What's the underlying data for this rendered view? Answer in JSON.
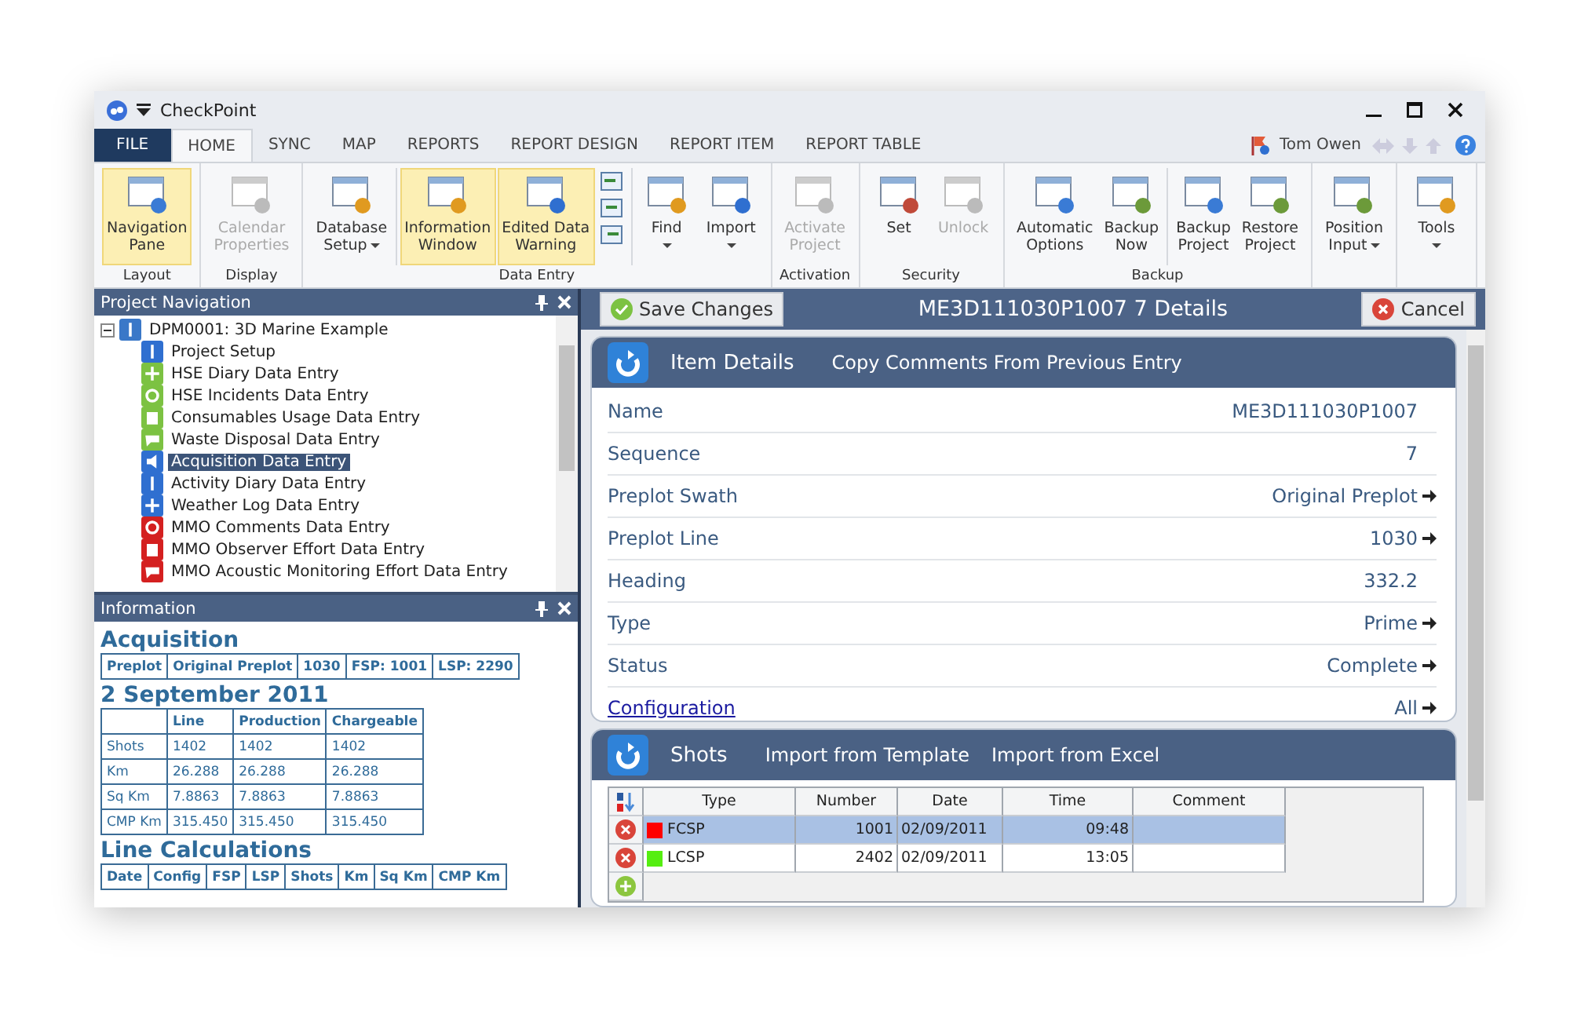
{
  "window": {
    "title": "CheckPoint"
  },
  "tabs": [
    {
      "label": "FILE",
      "kind": "file",
      "selected": false
    },
    {
      "label": "HOME",
      "kind": "tab",
      "selected": true
    },
    {
      "label": "SYNC",
      "kind": "tab",
      "selected": false
    },
    {
      "label": "MAP",
      "kind": "tab",
      "selected": false
    },
    {
      "label": "REPORTS",
      "kind": "tab",
      "selected": false
    },
    {
      "label": "REPORT DESIGN",
      "kind": "tab",
      "selected": false
    },
    {
      "label": "REPORT ITEM",
      "kind": "tab",
      "selected": false
    },
    {
      "label": "REPORT TABLE",
      "kind": "tab",
      "selected": false
    }
  ],
  "user": {
    "name": "Tom Owen"
  },
  "ribbon": {
    "groups": [
      {
        "label": "Layout",
        "sections": [
          [
            {
              "kind": "large",
              "lines": [
                "Navigation",
                "Pane"
              ],
              "selected": true,
              "disabled": false,
              "dropdown": false
            }
          ]
        ]
      },
      {
        "label": "Display",
        "sections": [
          [
            {
              "kind": "large",
              "lines": [
                "Calendar",
                "Properties"
              ],
              "selected": false,
              "disabled": true,
              "dropdown": false
            }
          ]
        ]
      },
      {
        "label": "Data Entry",
        "sections": [
          [
            {
              "kind": "large",
              "lines": [
                "Database",
                "Setup"
              ],
              "selected": false,
              "disabled": false,
              "dropdown": true
            }
          ],
          [
            {
              "kind": "large",
              "lines": [
                "Information",
                "Window"
              ],
              "selected": true,
              "disabled": false,
              "dropdown": false
            },
            {
              "kind": "large",
              "lines": [
                "Edited Data",
                "Warning"
              ],
              "selected": true,
              "disabled": false,
              "dropdown": false
            },
            {
              "kind": "icon_stack"
            }
          ],
          [
            {
              "kind": "large",
              "lines": [
                "Find"
              ],
              "selected": false,
              "disabled": false,
              "dropdown": true
            },
            {
              "kind": "large",
              "lines": [
                "Import"
              ],
              "selected": false,
              "disabled": false,
              "dropdown": true
            }
          ]
        ]
      },
      {
        "label": "Activation",
        "sections": [
          [
            {
              "kind": "large",
              "lines": [
                "Activate",
                "Project"
              ],
              "selected": false,
              "disabled": true,
              "dropdown": false
            }
          ]
        ]
      },
      {
        "label": "Security",
        "sections": [
          [
            {
              "kind": "large",
              "lines": [
                "Set"
              ],
              "selected": false,
              "disabled": false,
              "dropdown": false
            },
            {
              "kind": "large",
              "lines": [
                "Unlock"
              ],
              "selected": false,
              "disabled": true,
              "dropdown": false
            }
          ]
        ]
      },
      {
        "label": "Backup",
        "sections": [
          [
            {
              "kind": "large",
              "lines": [
                "Automatic",
                "Options"
              ],
              "selected": false,
              "disabled": false,
              "dropdown": false
            },
            {
              "kind": "large",
              "lines": [
                "Backup",
                "Now"
              ],
              "selected": false,
              "disabled": false,
              "dropdown": false
            }
          ],
          [
            {
              "kind": "large",
              "lines": [
                "Backup",
                "Project"
              ],
              "selected": false,
              "disabled": false,
              "dropdown": false
            },
            {
              "kind": "large",
              "lines": [
                "Restore",
                "Project"
              ],
              "selected": false,
              "disabled": false,
              "dropdown": false
            }
          ]
        ]
      },
      {
        "sections": [
          [
            {
              "kind": "large",
              "lines": [
                "Position",
                "Input"
              ],
              "selected": false,
              "disabled": false,
              "dropdown": true
            }
          ]
        ]
      },
      {
        "sections": [
          [
            {
              "kind": "large",
              "lines": [
                "Tools"
              ],
              "selected": false,
              "disabled": false,
              "dropdown": true
            }
          ]
        ]
      }
    ]
  },
  "navigation": {
    "title": "Project Navigation",
    "tree": [
      {
        "label": "DPM0001: 3D Marine Example",
        "expanded": true,
        "selected": false,
        "color": "#3a78c8",
        "children": [
          {
            "label": "Project Setup",
            "selected": false,
            "color": "#2f6fd0"
          },
          {
            "label": "HSE Diary Data Entry",
            "selected": false,
            "color": "#7cc242"
          },
          {
            "label": "HSE Incidents Data Entry",
            "selected": false,
            "color": "#7cc242"
          },
          {
            "label": "Consumables Usage Data Entry",
            "selected": false,
            "color": "#7cc242"
          },
          {
            "label": "Waste Disposal Data Entry",
            "selected": false,
            "color": "#7cc242"
          },
          {
            "label": "Acquisition Data Entry",
            "selected": true,
            "color": "#2f6fd0"
          },
          {
            "label": "Activity Diary Data Entry",
            "selected": false,
            "color": "#2f6fd0"
          },
          {
            "label": "Weather Log Data Entry",
            "selected": false,
            "color": "#2f6fd0"
          },
          {
            "label": "MMO Comments Data Entry",
            "selected": false,
            "color": "#d42020"
          },
          {
            "label": "MMO Observer Effort Data Entry",
            "selected": false,
            "color": "#d42020"
          },
          {
            "label": "MMO Acoustic Monitoring Effort Data Entry",
            "selected": false,
            "color": "#d42020"
          }
        ]
      }
    ]
  },
  "information": {
    "title": "Information",
    "sections": [
      {
        "heading": "Acquisition",
        "rows": [
          [
            "Preplot",
            "Original Preplot",
            "1030",
            "FSP: 1001",
            "LSP: 2290"
          ]
        ]
      },
      {
        "heading": "2 September 2011",
        "rows": [
          [
            "",
            "Line",
            "Production",
            "Chargeable"
          ],
          [
            "Shots",
            "1402",
            "1402",
            "1402"
          ],
          [
            "Km",
            "26.288",
            "26.288",
            "26.288"
          ],
          [
            "Sq Km",
            "7.8863",
            "7.8863",
            "7.8863"
          ],
          [
            "CMP Km",
            "315.450",
            "315.450",
            "315.450"
          ]
        ]
      },
      {
        "heading": "Line Calculations",
        "rows": [
          [
            "Date",
            "Config",
            "FSP",
            "LSP",
            "Shots",
            "Km",
            "Sq Km",
            "CMP Km"
          ]
        ]
      }
    ]
  },
  "details": {
    "save_button": "Save Changes",
    "title": "ME3D111030P1007 7 Details",
    "cancel_button": "Cancel",
    "item_card": {
      "title": "Item Details",
      "actions": [
        "Copy Comments From Previous Entry"
      ],
      "fields": [
        {
          "label": "Name",
          "value": "ME3D111030P1007",
          "kind": "text",
          "arrow": false
        },
        {
          "label": "Sequence",
          "value": "7",
          "kind": "text",
          "arrow": false
        },
        {
          "label": "Preplot Swath",
          "value": "Original Preplot",
          "kind": "text",
          "arrow": true
        },
        {
          "label": "Preplot Line",
          "value": "1030",
          "kind": "text",
          "arrow": true
        },
        {
          "label": "Heading",
          "value": "332.2",
          "kind": "text",
          "arrow": false
        },
        {
          "label": "Type",
          "value": "Prime",
          "kind": "text",
          "arrow": true
        },
        {
          "label": "Status",
          "value": "Complete",
          "kind": "text",
          "arrow": true
        },
        {
          "label": "Configuration",
          "value": "All",
          "kind": "link",
          "arrow": true
        }
      ]
    },
    "shots_card": {
      "title": "Shots",
      "actions": [
        "Import from Template",
        "Import from Excel"
      ],
      "columns": [
        "Type",
        "Number",
        "Date",
        "Time",
        "Comment"
      ],
      "rows": [
        {
          "type": "FCSP",
          "color": "#ff0000",
          "number": "1001",
          "date": "02/09/2011",
          "time": "09:48",
          "selected": true
        },
        {
          "type": "LCSP",
          "color": "#55ee11",
          "number": "2402",
          "date": "02/09/2011",
          "time": "13:05",
          "selected": false
        }
      ]
    }
  }
}
